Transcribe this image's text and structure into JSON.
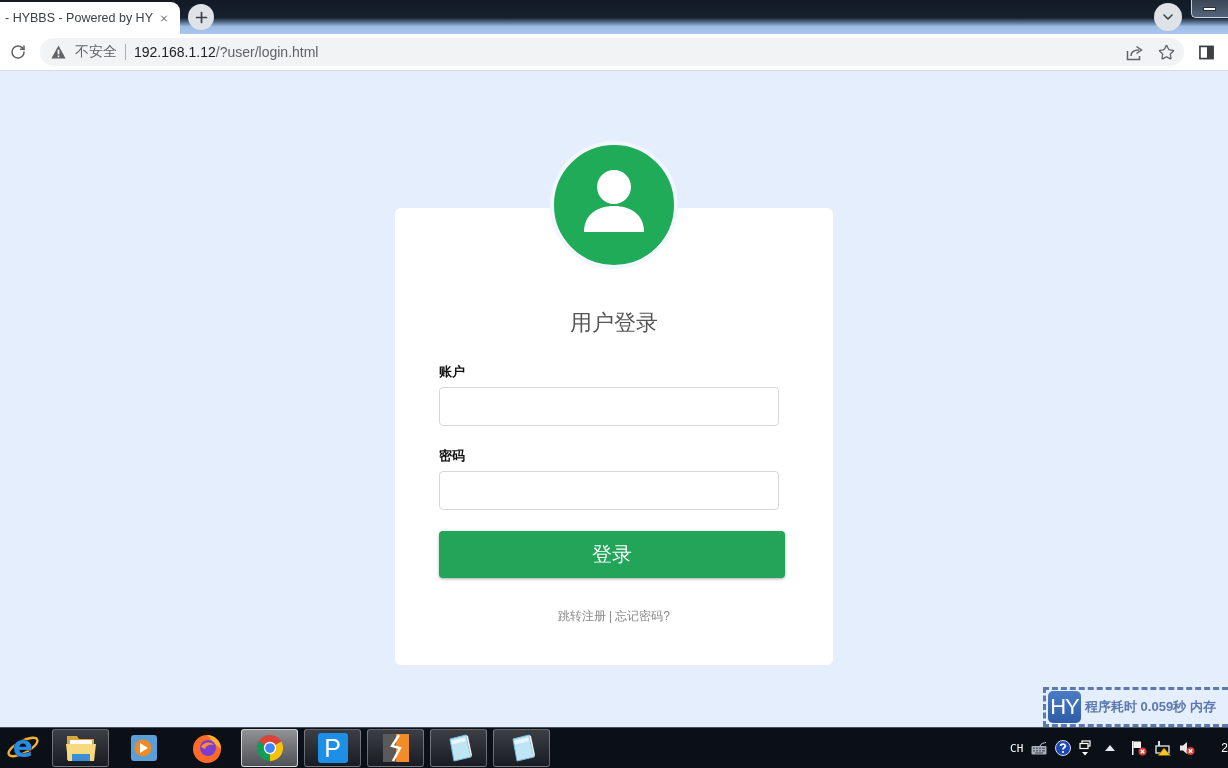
{
  "browser": {
    "tab": {
      "title": "- HYBBS - Powered by HY"
    },
    "address_bar": {
      "security_label": "不安全",
      "url_host": "192.168.1.12",
      "url_path": "/?user/login.html"
    }
  },
  "login": {
    "title": "用户登录",
    "fields": [
      {
        "label": "账户"
      },
      {
        "label": "密码"
      }
    ],
    "submit": "登录",
    "links": [
      {
        "text": "跳转注册"
      },
      {
        "text": "忘记密码?"
      }
    ],
    "link_separator": "|"
  },
  "debug_bar": {
    "logo": "HY",
    "text": "程序耗时 0.059秒 内存"
  },
  "taskbar": {
    "items": [
      {
        "kind": "e-logo",
        "glyph": "e",
        "open": false,
        "selected": false
      },
      {
        "kind": "folder",
        "open": true,
        "selected": false
      },
      {
        "kind": "media",
        "open": false,
        "selected": false
      },
      {
        "kind": "fox",
        "open": false,
        "selected": false
      },
      {
        "kind": "wheel",
        "open": true,
        "selected": true
      },
      {
        "kind": "p-app",
        "glyph": "P",
        "open": true,
        "selected": false
      },
      {
        "kind": "bolt",
        "open": true,
        "selected": false
      },
      {
        "kind": "notepad",
        "open": true,
        "selected": false
      },
      {
        "kind": "notepad",
        "open": true,
        "selected": false
      }
    ],
    "tray": {
      "language": "CH",
      "clock": "2"
    }
  }
}
